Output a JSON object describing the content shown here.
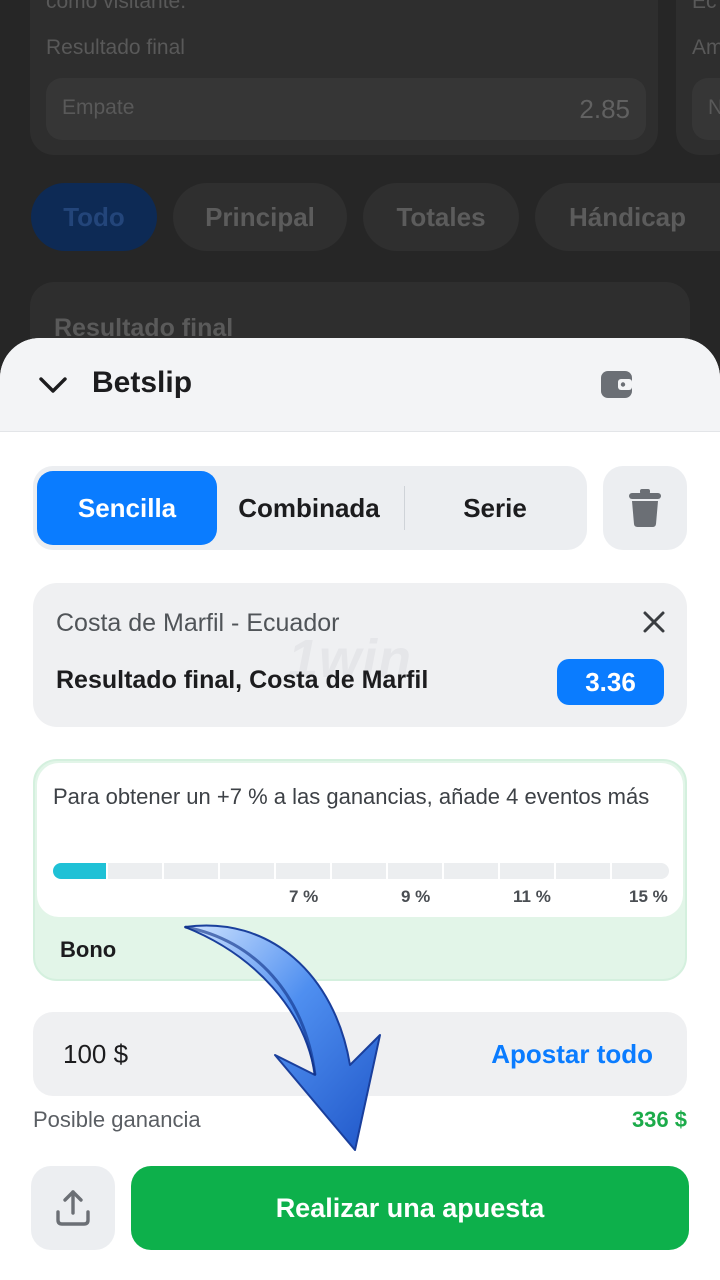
{
  "background": {
    "card_text_top": "como visitante.",
    "card_label": "Resultado final",
    "card_option": "Empate",
    "card_odds": "2.85",
    "right_text_a": "Ec",
    "right_text_b": "Am",
    "right_text_c": "N",
    "tabs": [
      {
        "label": "Todo",
        "active": true
      },
      {
        "label": "Principal",
        "active": false
      },
      {
        "label": "Totales",
        "active": false
      },
      {
        "label": "Hándicap",
        "active": false
      }
    ],
    "section_title": "Resultado final"
  },
  "betslip": {
    "title": "Betslip",
    "icons": {
      "collapse": "chevron-down-icon",
      "wallet": "wallet-icon",
      "trash": "trash-icon",
      "close": "close-icon",
      "share": "share-icon"
    },
    "mode_tabs": [
      {
        "label": "Sencilla",
        "active": true
      },
      {
        "label": "Combinada",
        "active": false
      },
      {
        "label": "Serie",
        "active": false
      }
    ],
    "bet": {
      "match": "Costa de Marfil - Ecuador",
      "market": "Resultado final, Costa de Marfil",
      "odds": "3.36",
      "watermark": "1win"
    },
    "bonus": {
      "message": "Para obtener un +7 % a las ganancias, añade 4 eventos más",
      "progress_fraction": 0.09,
      "ticks": [
        "7 %",
        "9 %",
        "11 %",
        "15 %"
      ],
      "label": "Bono"
    },
    "stake": {
      "amount": "100 $",
      "bet_all_label": "Apostar todo"
    },
    "possible_win": {
      "label": "Posible ganancia",
      "value": "336 $"
    },
    "place_bet_label": "Realizar una apuesta"
  },
  "colors": {
    "accent": "#0a7cff",
    "success": "#0db04b",
    "progress": "#1fc1d6"
  }
}
